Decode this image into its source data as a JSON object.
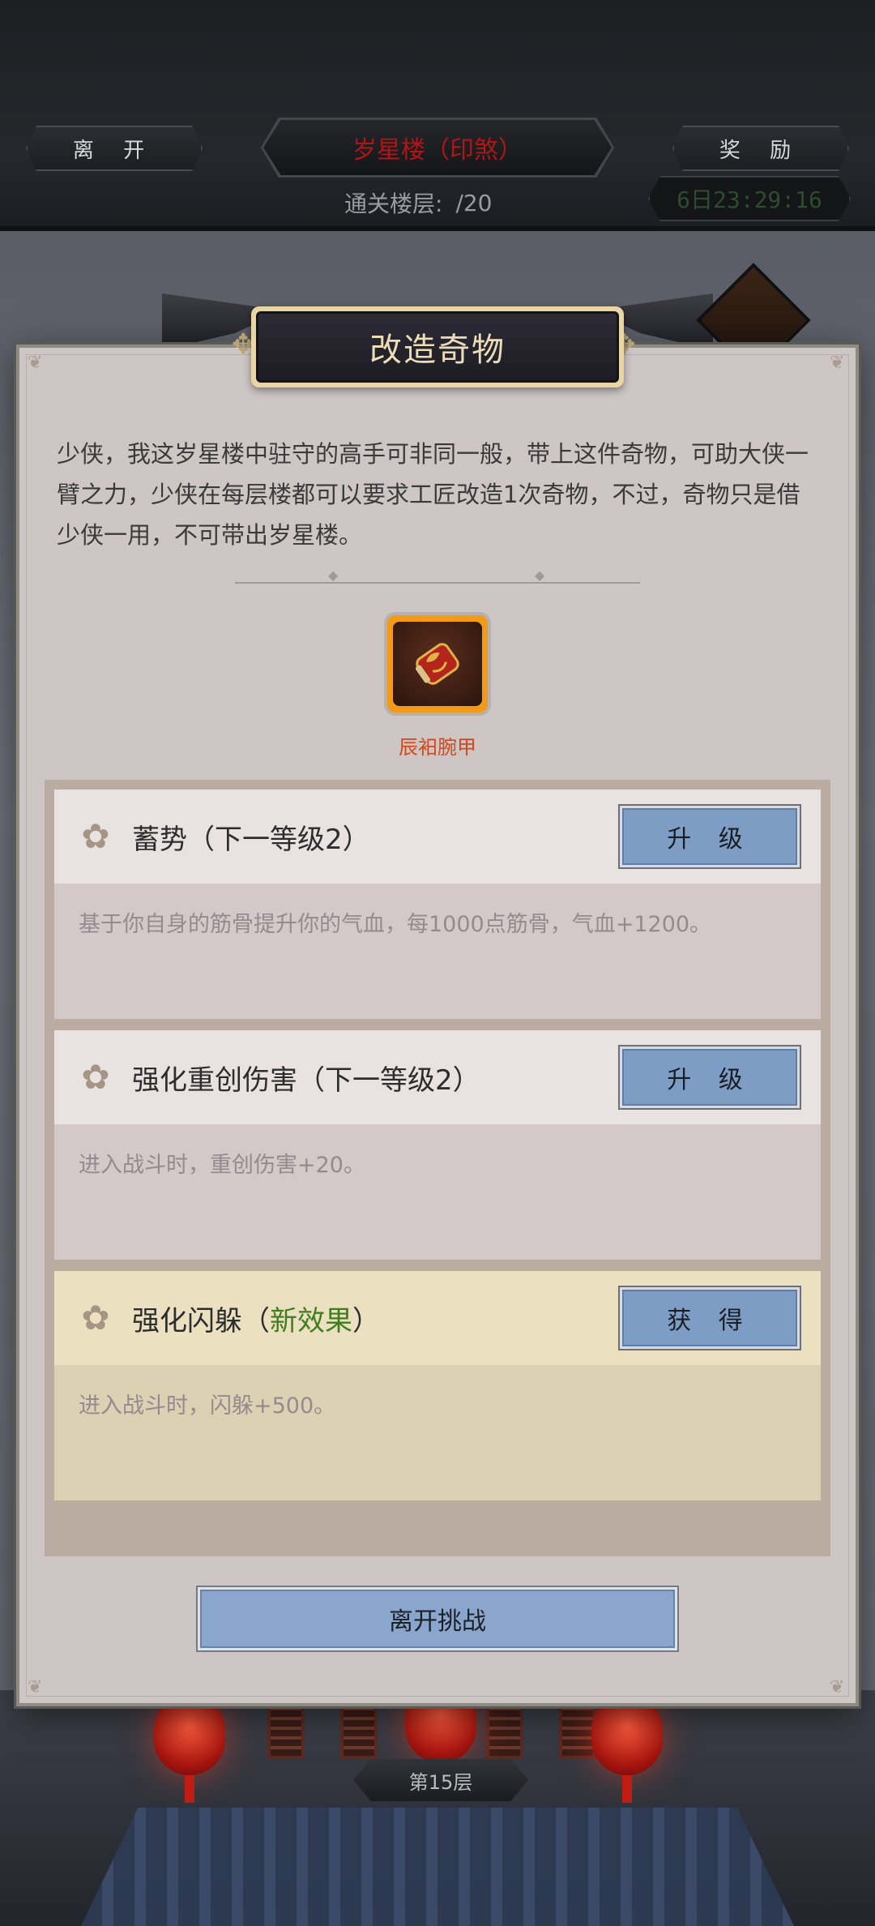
{
  "top_bar": {
    "leave_label": "离 开",
    "tower_name": "岁星楼（印煞）",
    "reward_label": "奖 励",
    "floor_progress_label": "通关楼层:",
    "floor_progress_current": "",
    "floor_progress_total": "/20",
    "timer": "6日23:29:16"
  },
  "dialog": {
    "title": "改造奇物",
    "intro": "少侠，我这岁星楼中驻守的高手可非同一般，带上这件奇物，可助大侠一臂之力，少侠在每层楼都可以要求工匠改造1次奇物，不过，奇物只是借少侠一用，不可带出岁星楼。",
    "item_name": "辰衵腕甲",
    "upgrades": [
      {
        "title": "蓄势（下一等级2）",
        "description": "基于你自身的筋骨提升你的气血，每1000点筋骨，气血+1200。",
        "button": "升 级"
      },
      {
        "title": "强化重创伤害（下一等级2）",
        "description": "进入战斗时，重创伤害+20。",
        "button": "升 级"
      },
      {
        "title_prefix": "强化闪躲（",
        "title_highlight": "新效果",
        "title_suffix": "）",
        "description": "进入战斗时，闪躲+500。",
        "button": "获 得"
      }
    ],
    "leave_button": "离开挑战"
  },
  "scene": {
    "floor_tag": "第15层"
  },
  "colors": {
    "accent_button": "#7e9dc5",
    "new_effect": "#3f7d1e",
    "item_name": "#d5461b",
    "tower_name": "#b01616"
  }
}
